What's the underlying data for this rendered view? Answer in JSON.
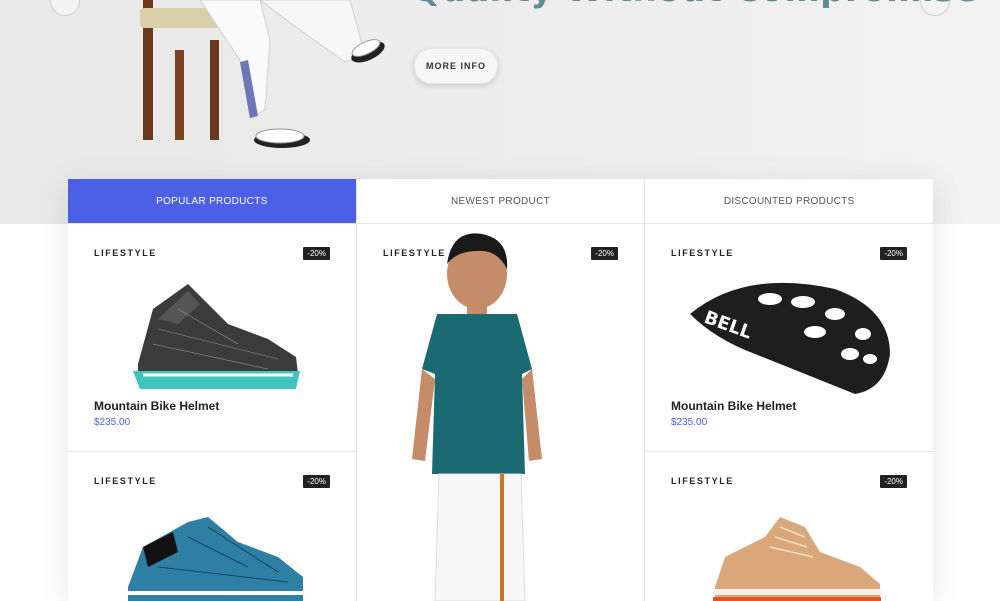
{
  "hero": {
    "title": "Quality Without Compromise",
    "button_label": "MORE INFO"
  },
  "tabs": [
    {
      "label": "POPULAR PRODUCTS",
      "active": true
    },
    {
      "label": "NEWEST PRODUCT",
      "active": false
    },
    {
      "label": "DISCOUNTED PRODUCTS",
      "active": false
    }
  ],
  "products": [
    {
      "category": "LIFESTYLE",
      "discount": "-20%",
      "name": "Mountain Bike Helmet",
      "price": "$235.00"
    },
    {
      "category": "LIFESTYLE",
      "discount": "-20%",
      "name": "Mountain Bike Helmet",
      "price": "$235.00"
    },
    {
      "category": "LIFESTYLE",
      "discount": "-20%"
    },
    {
      "category": "LIFESTYLE",
      "discount": "-20%"
    },
    {
      "category": "LIFESTYLE",
      "discount": "-20%"
    }
  ],
  "colors": {
    "accent": "#4b60e4",
    "hero_title": "#5f8a99",
    "badge": "#222222"
  }
}
